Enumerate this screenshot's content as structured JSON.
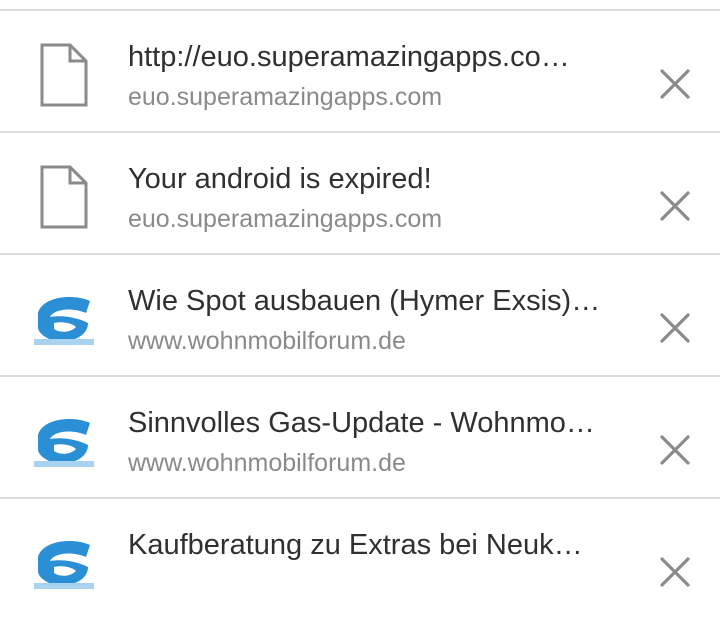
{
  "history": {
    "items": [
      {
        "title": "http://euo.superamazingapps.co…",
        "url": "euo.superamazingapps.com",
        "icon": "page-icon"
      },
      {
        "title": "Your android is expired!",
        "url": "euo.superamazingapps.com",
        "icon": "page-icon"
      },
      {
        "title": "Wie Spot ausbauen (Hymer Exsis)…",
        "url": "www.wohnmobilforum.de",
        "icon": "site-favicon"
      },
      {
        "title": "Sinnvolles Gas-Update - Wohnmo…",
        "url": "www.wohnmobilforum.de",
        "icon": "site-favicon"
      },
      {
        "title": "Kaufberatung zu Extras bei Neuk…",
        "url": "",
        "icon": "site-favicon"
      }
    ],
    "close_icon": "close-icon"
  },
  "colors": {
    "title": "#303030",
    "url": "#8a8a8a",
    "divider": "#dcdcdc",
    "icon": "#8a8a8a",
    "favicon": "#2b8fd6"
  }
}
